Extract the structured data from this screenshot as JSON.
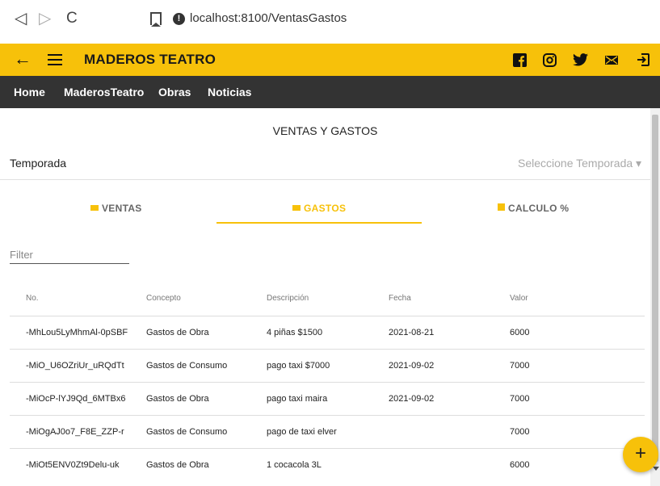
{
  "browser": {
    "url": "localhost:8100/VentasGastos",
    "back_glyph": "◁",
    "forward_glyph": "▷",
    "reload_glyph": "C",
    "info_glyph": "!"
  },
  "app": {
    "title": "MADEROS TEATRO",
    "accent_color": "#f7c10a",
    "back_glyph": "←",
    "social_icons": [
      "facebook-icon",
      "instagram-icon",
      "twitter-icon",
      "mail-icon",
      "logout-icon"
    ]
  },
  "nav": {
    "items": [
      "Home",
      "MaderosTeatro",
      "Obras",
      "Noticias"
    ]
  },
  "page": {
    "title": "VENTAS Y GASTOS",
    "temporada_label": "Temporada",
    "temporada_placeholder": "Seleccione Temporada ▾"
  },
  "tabs": {
    "ventas": "VENTAS",
    "gastos": "GASTOS",
    "calculo": "CALCULO %",
    "active": "gastos"
  },
  "filter": {
    "placeholder": "Filter"
  },
  "table": {
    "headers": [
      "No.",
      "Concepto",
      "Descripción",
      "Fecha",
      "Valor"
    ],
    "rows": [
      [
        "-MhLou5LyMhmAl-0pSBF",
        "Gastos de Obra",
        "4 piñas $1500",
        "2021-08-21",
        "6000"
      ],
      [
        "-MiO_U6OZriUr_uRQdTt",
        "Gastos de Consumo",
        "pago taxi $7000",
        "2021-09-02",
        "7000"
      ],
      [
        "-MiOcP-lYJ9Qd_6MTBx6",
        "Gastos de Obra",
        "pago taxi maira",
        "2021-09-02",
        "7000"
      ],
      [
        "-MiOgAJ0o7_F8E_ZZP-r",
        "Gastos de Consumo",
        "pago de taxi elver",
        "",
        "7000"
      ],
      [
        "-MiOt5ENV0Zt9Delu-uk",
        "Gastos de Obra",
        "1 cocacola 3L",
        "",
        "6000"
      ]
    ]
  },
  "fab": {
    "label": "+"
  }
}
